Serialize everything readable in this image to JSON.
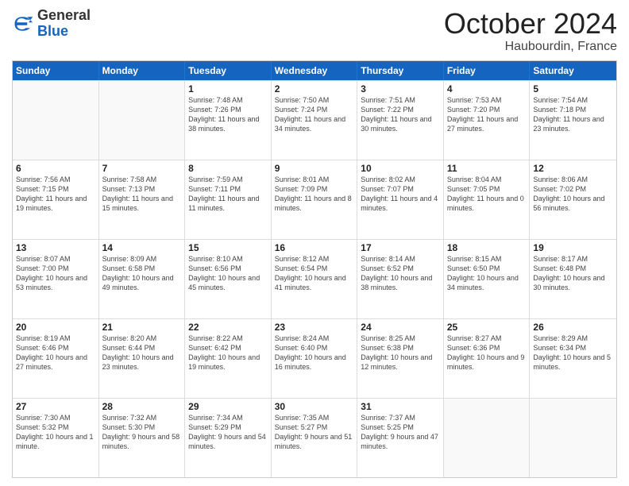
{
  "header": {
    "logo_general": "General",
    "logo_blue": "Blue",
    "month_title": "October 2024",
    "location": "Haubourdin, France"
  },
  "days_of_week": [
    "Sunday",
    "Monday",
    "Tuesday",
    "Wednesday",
    "Thursday",
    "Friday",
    "Saturday"
  ],
  "weeks": [
    [
      {
        "day": "",
        "info": ""
      },
      {
        "day": "",
        "info": ""
      },
      {
        "day": "1",
        "info": "Sunrise: 7:48 AM\nSunset: 7:26 PM\nDaylight: 11 hours and 38 minutes."
      },
      {
        "day": "2",
        "info": "Sunrise: 7:50 AM\nSunset: 7:24 PM\nDaylight: 11 hours and 34 minutes."
      },
      {
        "day": "3",
        "info": "Sunrise: 7:51 AM\nSunset: 7:22 PM\nDaylight: 11 hours and 30 minutes."
      },
      {
        "day": "4",
        "info": "Sunrise: 7:53 AM\nSunset: 7:20 PM\nDaylight: 11 hours and 27 minutes."
      },
      {
        "day": "5",
        "info": "Sunrise: 7:54 AM\nSunset: 7:18 PM\nDaylight: 11 hours and 23 minutes."
      }
    ],
    [
      {
        "day": "6",
        "info": "Sunrise: 7:56 AM\nSunset: 7:15 PM\nDaylight: 11 hours and 19 minutes."
      },
      {
        "day": "7",
        "info": "Sunrise: 7:58 AM\nSunset: 7:13 PM\nDaylight: 11 hours and 15 minutes."
      },
      {
        "day": "8",
        "info": "Sunrise: 7:59 AM\nSunset: 7:11 PM\nDaylight: 11 hours and 11 minutes."
      },
      {
        "day": "9",
        "info": "Sunrise: 8:01 AM\nSunset: 7:09 PM\nDaylight: 11 hours and 8 minutes."
      },
      {
        "day": "10",
        "info": "Sunrise: 8:02 AM\nSunset: 7:07 PM\nDaylight: 11 hours and 4 minutes."
      },
      {
        "day": "11",
        "info": "Sunrise: 8:04 AM\nSunset: 7:05 PM\nDaylight: 11 hours and 0 minutes."
      },
      {
        "day": "12",
        "info": "Sunrise: 8:06 AM\nSunset: 7:02 PM\nDaylight: 10 hours and 56 minutes."
      }
    ],
    [
      {
        "day": "13",
        "info": "Sunrise: 8:07 AM\nSunset: 7:00 PM\nDaylight: 10 hours and 53 minutes."
      },
      {
        "day": "14",
        "info": "Sunrise: 8:09 AM\nSunset: 6:58 PM\nDaylight: 10 hours and 49 minutes."
      },
      {
        "day": "15",
        "info": "Sunrise: 8:10 AM\nSunset: 6:56 PM\nDaylight: 10 hours and 45 minutes."
      },
      {
        "day": "16",
        "info": "Sunrise: 8:12 AM\nSunset: 6:54 PM\nDaylight: 10 hours and 41 minutes."
      },
      {
        "day": "17",
        "info": "Sunrise: 8:14 AM\nSunset: 6:52 PM\nDaylight: 10 hours and 38 minutes."
      },
      {
        "day": "18",
        "info": "Sunrise: 8:15 AM\nSunset: 6:50 PM\nDaylight: 10 hours and 34 minutes."
      },
      {
        "day": "19",
        "info": "Sunrise: 8:17 AM\nSunset: 6:48 PM\nDaylight: 10 hours and 30 minutes."
      }
    ],
    [
      {
        "day": "20",
        "info": "Sunrise: 8:19 AM\nSunset: 6:46 PM\nDaylight: 10 hours and 27 minutes."
      },
      {
        "day": "21",
        "info": "Sunrise: 8:20 AM\nSunset: 6:44 PM\nDaylight: 10 hours and 23 minutes."
      },
      {
        "day": "22",
        "info": "Sunrise: 8:22 AM\nSunset: 6:42 PM\nDaylight: 10 hours and 19 minutes."
      },
      {
        "day": "23",
        "info": "Sunrise: 8:24 AM\nSunset: 6:40 PM\nDaylight: 10 hours and 16 minutes."
      },
      {
        "day": "24",
        "info": "Sunrise: 8:25 AM\nSunset: 6:38 PM\nDaylight: 10 hours and 12 minutes."
      },
      {
        "day": "25",
        "info": "Sunrise: 8:27 AM\nSunset: 6:36 PM\nDaylight: 10 hours and 9 minutes."
      },
      {
        "day": "26",
        "info": "Sunrise: 8:29 AM\nSunset: 6:34 PM\nDaylight: 10 hours and 5 minutes."
      }
    ],
    [
      {
        "day": "27",
        "info": "Sunrise: 7:30 AM\nSunset: 5:32 PM\nDaylight: 10 hours and 1 minute."
      },
      {
        "day": "28",
        "info": "Sunrise: 7:32 AM\nSunset: 5:30 PM\nDaylight: 9 hours and 58 minutes."
      },
      {
        "day": "29",
        "info": "Sunrise: 7:34 AM\nSunset: 5:29 PM\nDaylight: 9 hours and 54 minutes."
      },
      {
        "day": "30",
        "info": "Sunrise: 7:35 AM\nSunset: 5:27 PM\nDaylight: 9 hours and 51 minutes."
      },
      {
        "day": "31",
        "info": "Sunrise: 7:37 AM\nSunset: 5:25 PM\nDaylight: 9 hours and 47 minutes."
      },
      {
        "day": "",
        "info": ""
      },
      {
        "day": "",
        "info": ""
      }
    ]
  ]
}
